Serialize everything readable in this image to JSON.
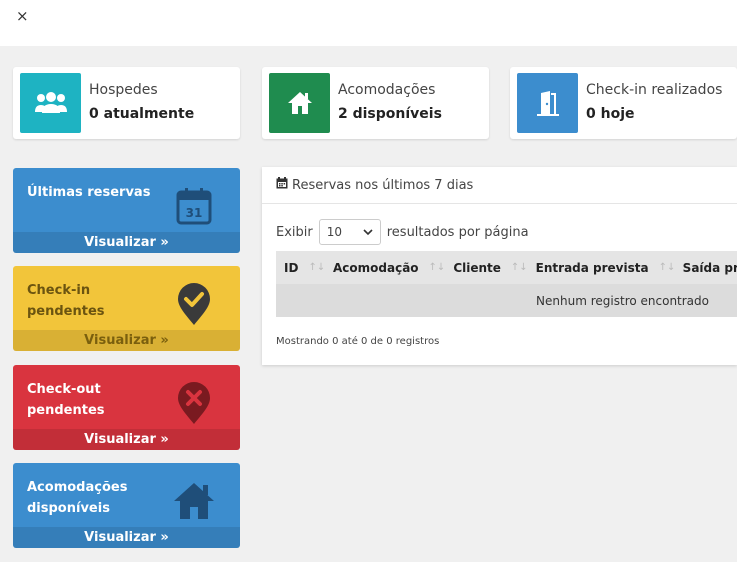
{
  "close_glyph": "×",
  "info_boxes": [
    {
      "label": "Hospedes",
      "value": "0 atualmente",
      "color": "#1eb3c2",
      "icon": "users-icon"
    },
    {
      "label": "Acomodações",
      "value": "2 disponíveis",
      "color": "#1f8c4f",
      "icon": "home-icon"
    },
    {
      "label": "Check-in realizados",
      "value": "0 hoje",
      "color": "#3c8dce",
      "icon": "door-open-icon"
    }
  ],
  "small_boxes": [
    {
      "title": "Últimas reservas",
      "footer": "Visualizar »",
      "color": "#3c8dce",
      "icon": "calendar-icon",
      "icon_text": "31"
    },
    {
      "title": "Check-in pendentes",
      "footer": "Visualizar »",
      "color": "#f2c53a",
      "icon": "check-pin-icon"
    },
    {
      "title": "Check-out pendentes",
      "footer": "Visualizar »",
      "color": "#d9343f",
      "icon": "cross-pin-icon"
    },
    {
      "title": "Acomodações disponíveis",
      "footer": "Visualizar »",
      "color": "#3c8dce",
      "icon": "house-icon"
    }
  ],
  "panel": {
    "title": "Reservas nos últimos 7 dias",
    "length_prefix": "Exibir",
    "length_value": "10",
    "length_suffix": "resultados por página",
    "columns": [
      "ID",
      "Acomodação",
      "Cliente",
      "Entrada prevista",
      "Saída pr"
    ],
    "empty_text": "Nenhum registro encontrado",
    "info_text": "Mostrando 0 até 0 de 0 registros"
  }
}
